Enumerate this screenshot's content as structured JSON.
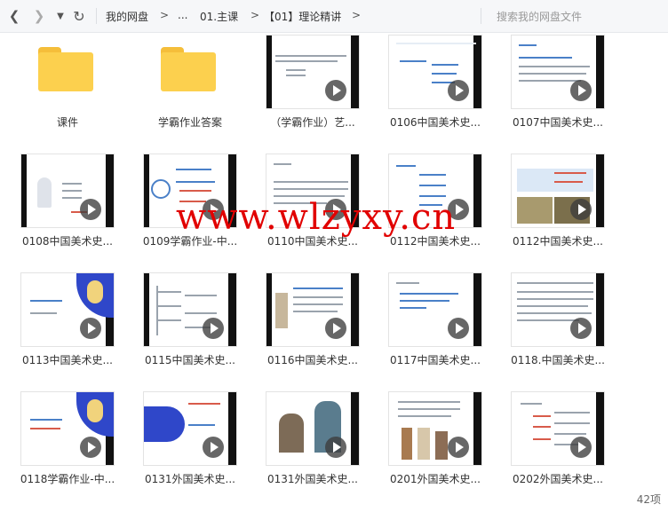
{
  "toolbar": {
    "breadcrumbs": [
      "我的网盘",
      "...",
      "01.主课",
      "【01】理论精讲"
    ],
    "search_placeholder": "搜索我的网盘文件",
    "separator": ">"
  },
  "items": [
    {
      "label": "课件",
      "kind": "folder"
    },
    {
      "label": "学霸作业答案",
      "kind": "folder"
    },
    {
      "label": "（学霸作业）艺...",
      "kind": "video"
    },
    {
      "label": "0106中国美术史...",
      "kind": "video"
    },
    {
      "label": "0107中国美术史...",
      "kind": "video"
    },
    {
      "label": "0108中国美术史...",
      "kind": "video"
    },
    {
      "label": "0109学霸作业-中...",
      "kind": "video"
    },
    {
      "label": "0110中国美术史...",
      "kind": "video"
    },
    {
      "label": "0112中国美术史...",
      "kind": "video"
    },
    {
      "label": "0112中国美术史...",
      "kind": "video"
    },
    {
      "label": "0113中国美术史...",
      "kind": "video"
    },
    {
      "label": "0115中国美术史...",
      "kind": "video"
    },
    {
      "label": "0116中国美术史...",
      "kind": "video"
    },
    {
      "label": "0117中国美术史...",
      "kind": "video"
    },
    {
      "label": "0118.中国美术史...",
      "kind": "video"
    },
    {
      "label": "0118学霸作业-中...",
      "kind": "video"
    },
    {
      "label": "0131外国美术史...",
      "kind": "video"
    },
    {
      "label": "0131外国美术史...",
      "kind": "video"
    },
    {
      "label": "0201外国美术史...",
      "kind": "video"
    },
    {
      "label": "0202外国美术史...",
      "kind": "video"
    }
  ],
  "watermark": "www.wlzyxy.cn",
  "status": "42项"
}
